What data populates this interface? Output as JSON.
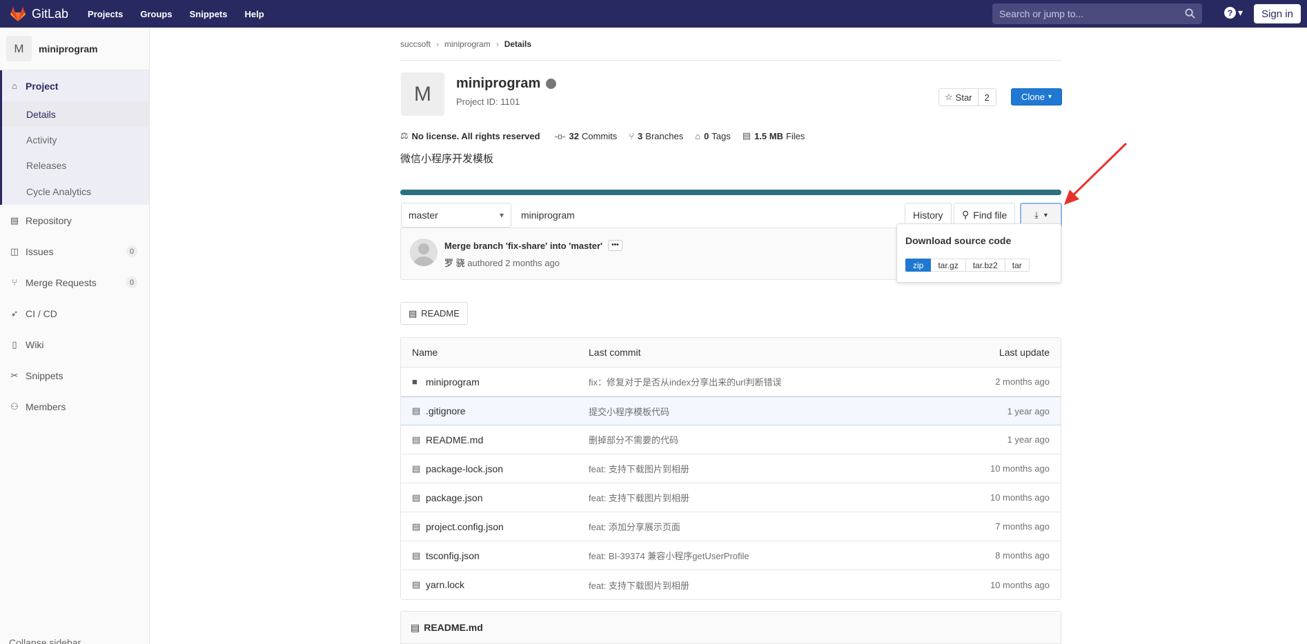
{
  "topbar": {
    "brand": "GitLab",
    "nav": [
      "Projects",
      "Groups",
      "Snippets",
      "Help"
    ],
    "search_placeholder": "Search or jump to...",
    "signin": "Sign in"
  },
  "sidebar": {
    "avatar_letter": "M",
    "project_name": "miniprogram",
    "project_label": "Project",
    "sub_items": [
      "Details",
      "Activity",
      "Releases",
      "Cycle Analytics"
    ],
    "items": [
      {
        "label": "Repository",
        "icon": "doc-icon"
      },
      {
        "label": "Issues",
        "icon": "issues-icon",
        "badge": "0"
      },
      {
        "label": "Merge Requests",
        "icon": "merge-icon",
        "badge": "0"
      },
      {
        "label": "CI / CD",
        "icon": "rocket-icon"
      },
      {
        "label": "Wiki",
        "icon": "book-icon"
      },
      {
        "label": "Snippets",
        "icon": "scissors-icon"
      },
      {
        "label": "Members",
        "icon": "users-icon"
      }
    ],
    "collapse": "Collapse sidebar"
  },
  "breadcrumb": [
    "succsoft",
    "miniprogram",
    "Details"
  ],
  "project": {
    "avatar_letter": "M",
    "title": "miniprogram",
    "project_id": "Project ID: 1101",
    "star_label": "Star",
    "star_count": "2",
    "clone_label": "Clone"
  },
  "stats": {
    "license": "No license. All rights reserved",
    "commits_n": "32",
    "commits": "Commits",
    "branches_n": "3",
    "branches": "Branches",
    "tags_n": "0",
    "tags": "Tags",
    "files_n": "1.5 MB",
    "files": "Files"
  },
  "description": "微信小程序开发模板",
  "language_bar_color": "#2b6e7f",
  "toolbar": {
    "branch": "master",
    "path": "miniprogram",
    "history": "History",
    "find_file": "Find file"
  },
  "download": {
    "title": "Download source code",
    "formats": [
      "zip",
      "tar.gz",
      "tar.bz2",
      "tar"
    ]
  },
  "commit": {
    "title": "Merge branch 'fix-share' into 'master'",
    "author": "罗 骁",
    "authored": "authored",
    "time": "2 months ago"
  },
  "readme_button": "README",
  "table": {
    "headers": {
      "name": "Name",
      "commit": "Last commit",
      "update": "Last update"
    },
    "rows": [
      {
        "name": "miniprogram",
        "type": "folder",
        "commit": "fix：修复对于是否从index分享出来的url判断错误",
        "update": "2 months ago"
      },
      {
        "name": ".gitignore",
        "type": "file",
        "commit": "提交小程序模板代码",
        "update": "1 year ago"
      },
      {
        "name": "README.md",
        "type": "file",
        "commit": "删掉部分不需要的代码",
        "update": "1 year ago"
      },
      {
        "name": "package-lock.json",
        "type": "file",
        "commit": "feat: 支持下载图片到相册",
        "update": "10 months ago"
      },
      {
        "name": "package.json",
        "type": "file",
        "commit": "feat: 支持下载图片到相册",
        "update": "10 months ago"
      },
      {
        "name": "project.config.json",
        "type": "file",
        "commit": "feat: 添加分享展示页面",
        "update": "7 months ago"
      },
      {
        "name": "tsconfig.json",
        "type": "file",
        "commit": "feat: BI-39374 兼容小程序getUserProfile",
        "update": "8 months ago"
      },
      {
        "name": "yarn.lock",
        "type": "file",
        "commit": "feat: 支持下载图片到相册",
        "update": "10 months ago"
      }
    ]
  },
  "readme_panel": "README.md"
}
